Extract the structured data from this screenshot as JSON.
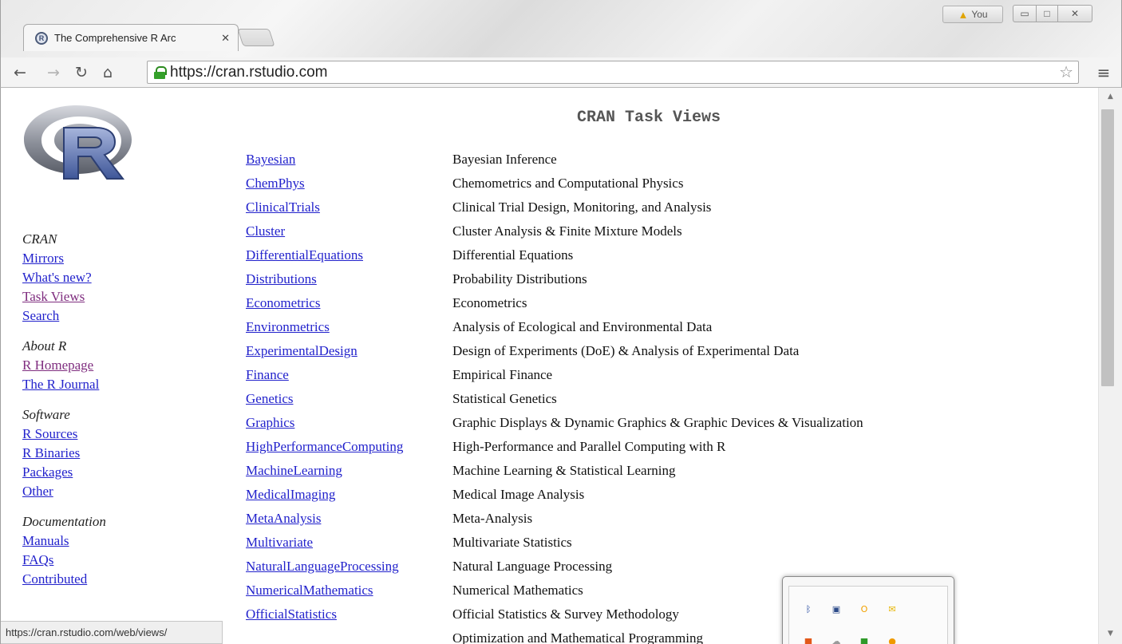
{
  "browser": {
    "tab_title": "The Comprehensive R Arc",
    "tab_close": "✕",
    "user_badge": "You",
    "url": "https://cran.rstudio.com",
    "status_url": "https://cran.rstudio.com/web/views/"
  },
  "page": {
    "title": "CRAN Task Views"
  },
  "sidebar": [
    {
      "heading": "CRAN",
      "links": [
        {
          "label": "Mirrors",
          "visited": false
        },
        {
          "label": "What's new?",
          "visited": false
        },
        {
          "label": "Task Views",
          "visited": true
        },
        {
          "label": "Search",
          "visited": false
        }
      ]
    },
    {
      "heading": "About R",
      "links": [
        {
          "label": "R Homepage",
          "visited": true
        },
        {
          "label": "The R Journal",
          "visited": false
        }
      ]
    },
    {
      "heading": "Software",
      "links": [
        {
          "label": "R Sources",
          "visited": false
        },
        {
          "label": "R Binaries",
          "visited": false
        },
        {
          "label": "Packages",
          "visited": false
        },
        {
          "label": "Other",
          "visited": false
        }
      ]
    },
    {
      "heading": "Documentation",
      "links": [
        {
          "label": "Manuals",
          "visited": false
        },
        {
          "label": "FAQs",
          "visited": false
        },
        {
          "label": "Contributed",
          "visited": false
        }
      ]
    }
  ],
  "task_views": [
    {
      "name": "Bayesian",
      "description": "Bayesian Inference"
    },
    {
      "name": "ChemPhys",
      "description": "Chemometrics and Computational Physics"
    },
    {
      "name": "ClinicalTrials",
      "description": "Clinical Trial Design, Monitoring, and Analysis"
    },
    {
      "name": "Cluster",
      "description": "Cluster Analysis & Finite Mixture Models"
    },
    {
      "name": "DifferentialEquations",
      "description": "Differential Equations"
    },
    {
      "name": "Distributions",
      "description": "Probability Distributions"
    },
    {
      "name": "Econometrics",
      "description": "Econometrics"
    },
    {
      "name": "Environmetrics",
      "description": "Analysis of Ecological and Environmental Data"
    },
    {
      "name": "ExperimentalDesign",
      "description": "Design of Experiments (DoE) & Analysis of Experimental Data"
    },
    {
      "name": "Finance",
      "description": "Empirical Finance"
    },
    {
      "name": "Genetics",
      "description": "Statistical Genetics"
    },
    {
      "name": "Graphics",
      "description": "Graphic Displays & Dynamic Graphics & Graphic Devices & Visualization"
    },
    {
      "name": "HighPerformanceComputing",
      "description": "High-Performance and Parallel Computing with R"
    },
    {
      "name": "MachineLearning",
      "description": "Machine Learning & Statistical Learning"
    },
    {
      "name": "MedicalImaging",
      "description": "Medical Image Analysis"
    },
    {
      "name": "MetaAnalysis",
      "description": "Meta-Analysis"
    },
    {
      "name": "Multivariate",
      "description": "Multivariate Statistics"
    },
    {
      "name": "NaturalLanguageProcessing",
      "description": "Natural Language Processing"
    },
    {
      "name": "NumericalMathematics",
      "description": "Numerical Mathematics"
    },
    {
      "name": "OfficialStatistics",
      "description": "Official Statistics & Survey Methodology"
    },
    {
      "name": "",
      "description": "Optimization and Mathematical Programming"
    }
  ],
  "tray": {
    "icons": [
      {
        "icon": "bluetooth-icon",
        "color": "#1a3f9a"
      },
      {
        "icon": "network-monitor-icon",
        "color": "#2b4a88"
      },
      {
        "icon": "outlook-icon",
        "color": "#f2a100"
      },
      {
        "icon": "mail-envelope-icon",
        "color": "#e7b400"
      },
      {
        "icon": "office-icon",
        "color": "#e2581a"
      },
      {
        "icon": "cloud-sync-icon",
        "color": "#9a9a9a"
      },
      {
        "icon": "green-app-icon",
        "color": "#2f9a2a"
      },
      {
        "icon": "orange-app-icon",
        "color": "#f09a00"
      }
    ]
  },
  "colors": {
    "link": "#2222cc",
    "visited_link": "#7f2d7f",
    "title_text": "#555555"
  }
}
